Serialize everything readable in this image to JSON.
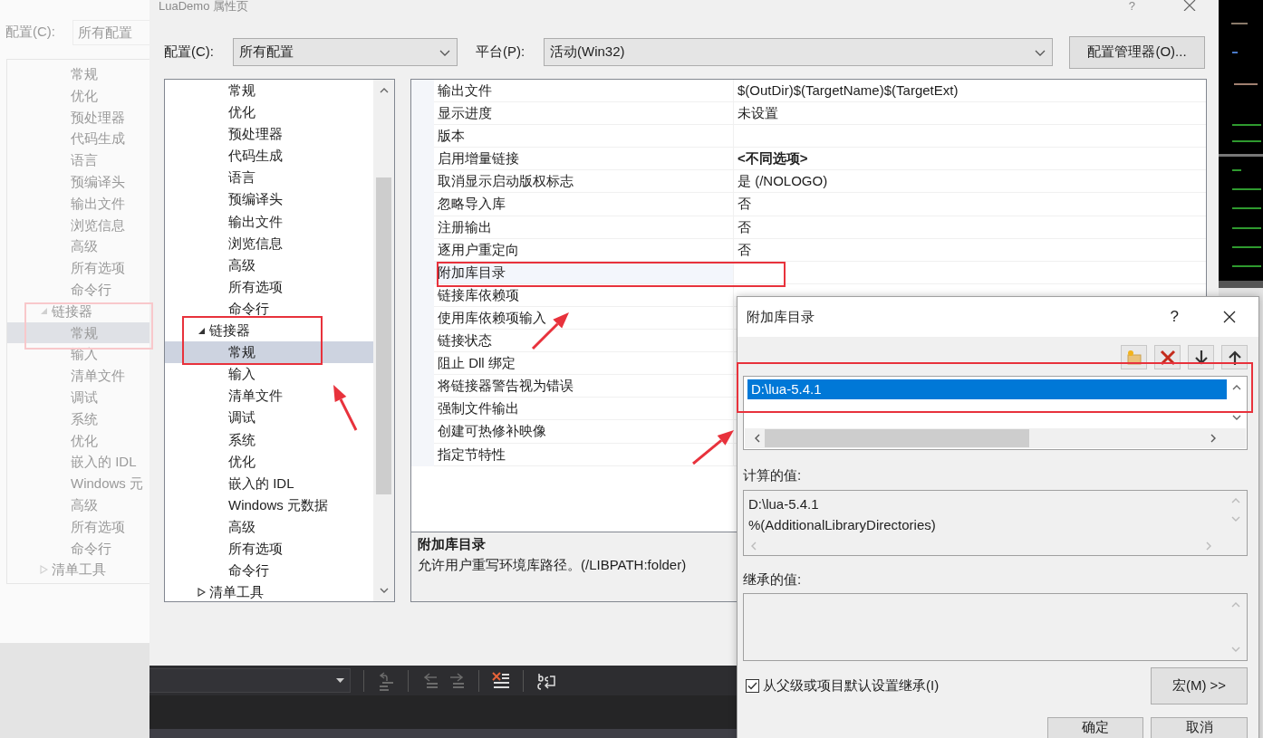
{
  "background_window": {
    "config_label": "配置(C):",
    "config_value": "所有配置",
    "tree": [
      {
        "children": [
          {
            "label": "常规",
            "selected": false
          },
          {
            "label": "优化",
            "selected": false
          },
          {
            "label": "预处理器",
            "selected": false
          },
          {
            "label": "代码生成",
            "selected": false
          },
          {
            "label": "语言",
            "selected": false
          },
          {
            "label": "预编译头",
            "selected": false
          },
          {
            "label": "输出文件",
            "selected": false
          },
          {
            "label": "浏览信息",
            "selected": false
          },
          {
            "label": "高级",
            "selected": false
          },
          {
            "label": "所有选项",
            "selected": false
          },
          {
            "label": "命令行",
            "selected": false
          }
        ]
      },
      {
        "label": "链接器",
        "selected": false,
        "expanded": true,
        "children": [
          {
            "label": "常规",
            "selected": true
          },
          {
            "label": "输入",
            "selected": false
          },
          {
            "label": "清单文件",
            "selected": false
          },
          {
            "label": "调试",
            "selected": false
          },
          {
            "label": "系统",
            "selected": false
          },
          {
            "label": "优化",
            "selected": false
          },
          {
            "label": "嵌入的 IDL",
            "selected": false
          },
          {
            "label": "Windows 元",
            "selected": false
          },
          {
            "label": "高级",
            "selected": false
          },
          {
            "label": "所有选项",
            "selected": false
          },
          {
            "label": "命令行",
            "selected": false
          }
        ]
      },
      {
        "label": "清单工具",
        "selected": false,
        "expanded": false
      }
    ]
  },
  "dialog": {
    "title": "LuaDemo 属性页",
    "help": "?",
    "config_label": "配置(C):",
    "config_value": "所有配置",
    "platform_label": "平台(P):",
    "platform_value": "活动(Win32)",
    "manager_button": "配置管理器(O)...",
    "tree": [
      {
        "children": [
          {
            "label": "常规",
            "selected": false
          },
          {
            "label": "优化",
            "selected": false
          },
          {
            "label": "预处理器",
            "selected": false
          },
          {
            "label": "代码生成",
            "selected": false
          },
          {
            "label": "语言",
            "selected": false
          },
          {
            "label": "预编译头",
            "selected": false
          },
          {
            "label": "输出文件",
            "selected": false
          },
          {
            "label": "浏览信息",
            "selected": false
          },
          {
            "label": "高级",
            "selected": false
          },
          {
            "label": "所有选项",
            "selected": false
          },
          {
            "label": "命令行",
            "selected": false
          }
        ]
      },
      {
        "label": "链接器",
        "selected": false,
        "expanded": true,
        "children": [
          {
            "label": "常规",
            "selected": true
          },
          {
            "label": "输入",
            "selected": false
          },
          {
            "label": "清单文件",
            "selected": false
          },
          {
            "label": "调试",
            "selected": false
          },
          {
            "label": "系统",
            "selected": false
          },
          {
            "label": "优化",
            "selected": false
          },
          {
            "label": "嵌入的 IDL",
            "selected": false
          },
          {
            "label": "Windows 元数据",
            "selected": false
          },
          {
            "label": "高级",
            "selected": false
          },
          {
            "label": "所有选项",
            "selected": false
          },
          {
            "label": "命令行",
            "selected": false
          }
        ]
      },
      {
        "label": "清单工具",
        "selected": false,
        "expanded": false
      }
    ],
    "properties": [
      {
        "name": "输出文件",
        "value": "$(OutDir)$(TargetName)$(TargetExt)",
        "bold": false,
        "selected": false
      },
      {
        "name": "显示进度",
        "value": "未设置",
        "bold": false,
        "selected": false
      },
      {
        "name": "版本",
        "selected": false
      },
      {
        "name": "启用增量链接",
        "value": "<不同选项>",
        "bold": true,
        "selected": false
      },
      {
        "name": "取消显示启动版权标志",
        "value": "是 (/NOLOGO)",
        "bold": false,
        "selected": false
      },
      {
        "name": "忽略导入库",
        "value": "否",
        "bold": false,
        "selected": false
      },
      {
        "name": "注册输出",
        "value": "否",
        "bold": false,
        "selected": false
      },
      {
        "name": "逐用户重定向",
        "value": "否",
        "bold": false,
        "selected": false
      },
      {
        "name": "附加库目录",
        "selected": true
      },
      {
        "name": "链接库依赖项",
        "selected": false
      },
      {
        "name": "使用库依赖项输入",
        "selected": false
      },
      {
        "name": "链接状态",
        "selected": false
      },
      {
        "name": "阻止 Dll 绑定",
        "selected": false
      },
      {
        "name": "将链接器警告视为错误",
        "selected": false
      },
      {
        "name": "强制文件输出",
        "selected": false
      },
      {
        "name": "创建可热修补映像",
        "selected": false
      },
      {
        "name": "指定节特性",
        "selected": false
      }
    ],
    "description": {
      "title": "附加库目录",
      "text": "允许用户重写环境库路径。(/LIBPATH:folder)"
    }
  },
  "sub_dialog": {
    "title": "附加库目录",
    "help": "?",
    "entries": [
      {
        "text": "D:\\lua-5.4.1",
        "selected": true
      }
    ],
    "computed_label": "计算的值:",
    "computed_lines": [
      "D:\\lua-5.4.1",
      "%(AdditionalLibraryDirectories)"
    ],
    "inherited_label": "继承的值:",
    "inherit_checkbox": {
      "label": "从父级或项目默认设置继承(I)",
      "checked": true
    },
    "macro_button": "宏(M) >>",
    "ok_button": "确定",
    "cancel_button": "取消"
  }
}
